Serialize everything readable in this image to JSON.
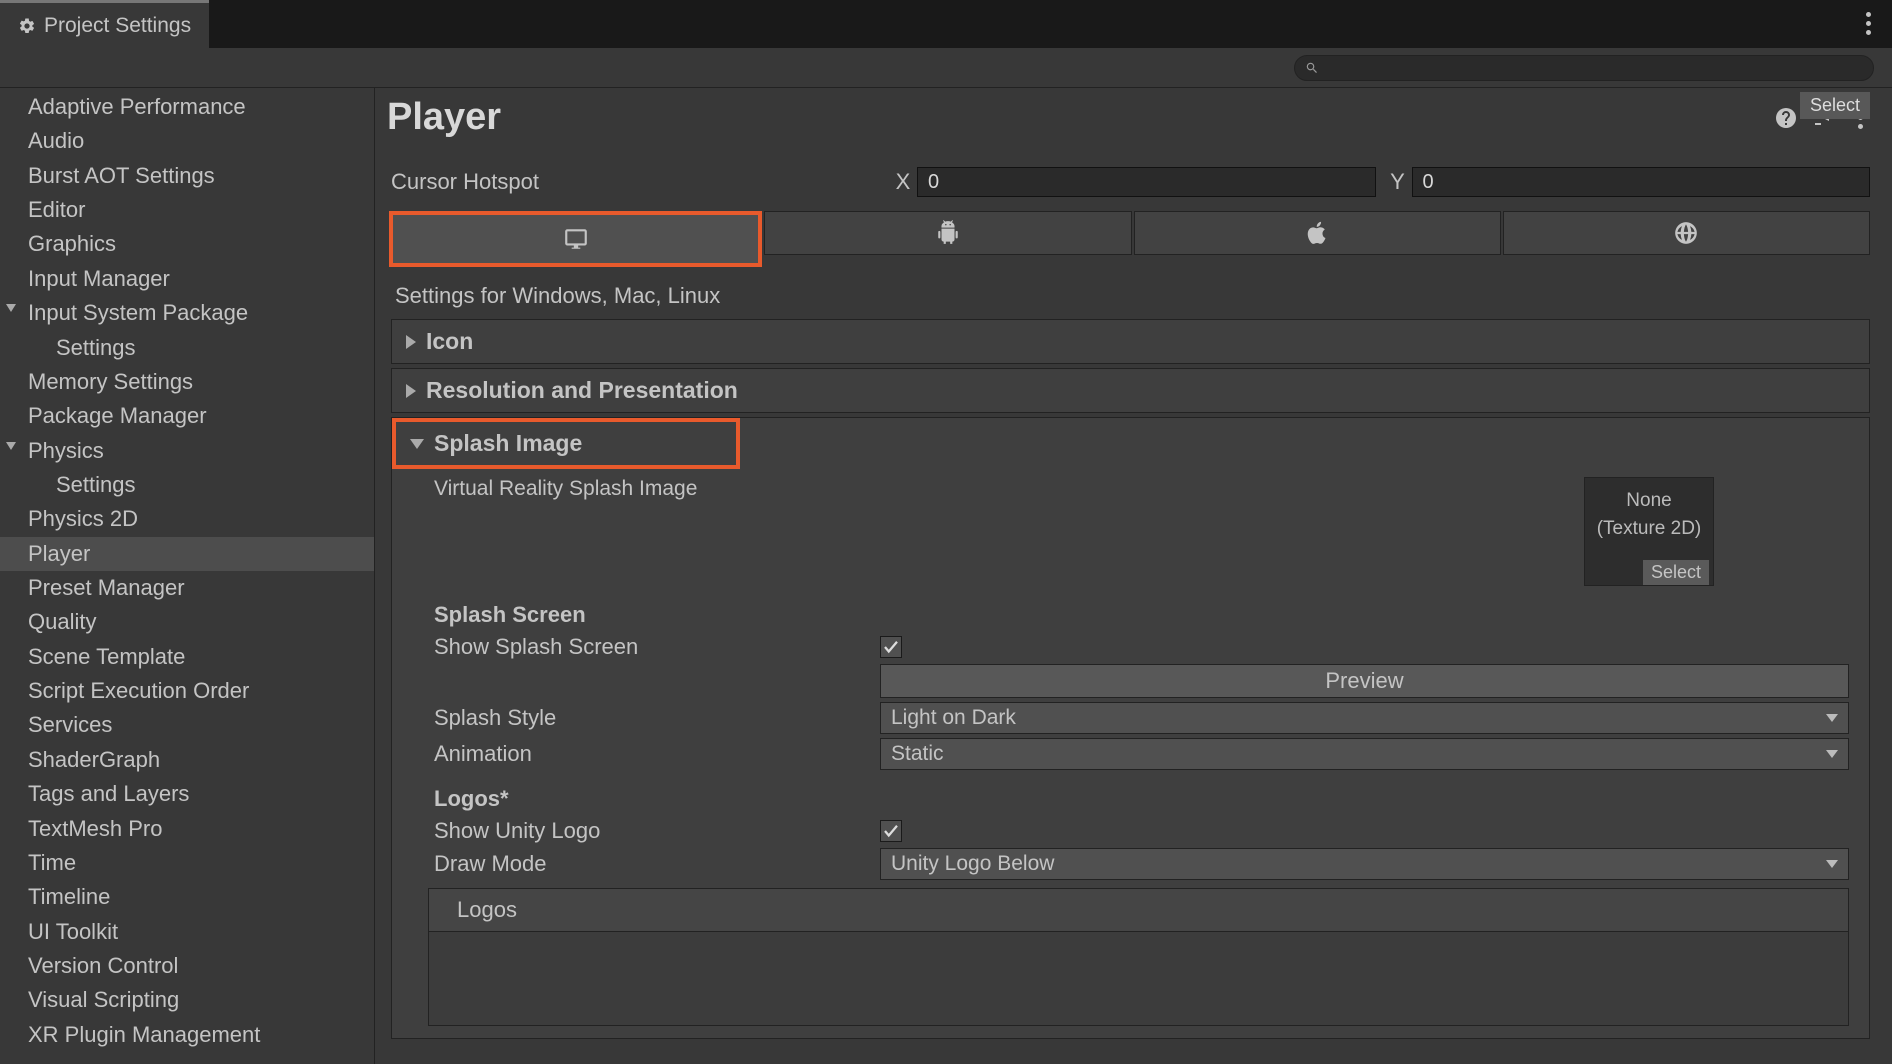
{
  "tab": {
    "title": "Project Settings"
  },
  "search": {
    "placeholder": ""
  },
  "sidebar": {
    "items": [
      {
        "label": "Adaptive Performance",
        "child": false,
        "arrow": false,
        "selected": false
      },
      {
        "label": "Audio",
        "child": false,
        "arrow": false,
        "selected": false
      },
      {
        "label": "Burst AOT Settings",
        "child": false,
        "arrow": false,
        "selected": false
      },
      {
        "label": "Editor",
        "child": false,
        "arrow": false,
        "selected": false
      },
      {
        "label": "Graphics",
        "child": false,
        "arrow": false,
        "selected": false
      },
      {
        "label": "Input Manager",
        "child": false,
        "arrow": false,
        "selected": false
      },
      {
        "label": "Input System Package",
        "child": false,
        "arrow": true,
        "selected": false
      },
      {
        "label": "Settings",
        "child": true,
        "arrow": false,
        "selected": false
      },
      {
        "label": "Memory Settings",
        "child": false,
        "arrow": false,
        "selected": false
      },
      {
        "label": "Package Manager",
        "child": false,
        "arrow": false,
        "selected": false
      },
      {
        "label": "Physics",
        "child": false,
        "arrow": true,
        "selected": false
      },
      {
        "label": "Settings",
        "child": true,
        "arrow": false,
        "selected": false
      },
      {
        "label": "Physics 2D",
        "child": false,
        "arrow": false,
        "selected": false
      },
      {
        "label": "Player",
        "child": false,
        "arrow": false,
        "selected": true
      },
      {
        "label": "Preset Manager",
        "child": false,
        "arrow": false,
        "selected": false
      },
      {
        "label": "Quality",
        "child": false,
        "arrow": false,
        "selected": false
      },
      {
        "label": "Scene Template",
        "child": false,
        "arrow": false,
        "selected": false
      },
      {
        "label": "Script Execution Order",
        "child": false,
        "arrow": false,
        "selected": false
      },
      {
        "label": "Services",
        "child": false,
        "arrow": false,
        "selected": false
      },
      {
        "label": "ShaderGraph",
        "child": false,
        "arrow": false,
        "selected": false
      },
      {
        "label": "Tags and Layers",
        "child": false,
        "arrow": false,
        "selected": false
      },
      {
        "label": "TextMesh Pro",
        "child": false,
        "arrow": false,
        "selected": false
      },
      {
        "label": "Time",
        "child": false,
        "arrow": false,
        "selected": false
      },
      {
        "label": "Timeline",
        "child": false,
        "arrow": false,
        "selected": false
      },
      {
        "label": "UI Toolkit",
        "child": false,
        "arrow": false,
        "selected": false
      },
      {
        "label": "Version Control",
        "child": false,
        "arrow": false,
        "selected": false
      },
      {
        "label": "Visual Scripting",
        "child": false,
        "arrow": false,
        "selected": false
      },
      {
        "label": "XR Plugin Management",
        "child": false,
        "arrow": false,
        "selected": false
      }
    ]
  },
  "page": {
    "title": "Player",
    "select_chip": "Select",
    "cursor_hotspot": {
      "label": "Cursor Hotspot",
      "x_label": "X",
      "x_value": "0",
      "y_label": "Y",
      "y_value": "0"
    },
    "settings_for": "Settings for Windows, Mac, Linux",
    "foldouts": {
      "icon": "Icon",
      "resolution": "Resolution and Presentation",
      "splash": "Splash Image"
    },
    "vr_splash_label": "Virtual Reality Splash Image",
    "texture_none": "None",
    "texture_type": "(Texture 2D)",
    "texture_select": "Select",
    "splash_screen_title": "Splash Screen",
    "show_splash_label": "Show Splash Screen",
    "preview_btn": "Preview",
    "splash_style_label": "Splash Style",
    "splash_style_value": "Light on Dark",
    "animation_label": "Animation",
    "animation_value": "Static",
    "logos_title": "Logos*",
    "show_unity_logo_label": "Show Unity Logo",
    "draw_mode_label": "Draw Mode",
    "draw_mode_value": "Unity Logo Below",
    "logos_header": "Logos"
  },
  "checks": {
    "show_splash": true,
    "show_unity_logo": true
  },
  "colors": {
    "highlight": "#e85a2c"
  }
}
